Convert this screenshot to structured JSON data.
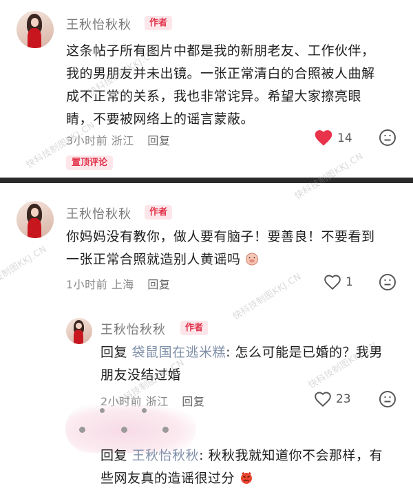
{
  "comments": [
    {
      "author": "王秋怡秋秋",
      "badge": "作者",
      "lines": [
        "这条帖子所有图片中都是我的新朋老友、工作伙伴，",
        "我的男朋友并未出镜。一张正常清白的合照被人曲解",
        "成不正常的关系，我也非常诧异。希望大家擦亮眼",
        "睛，不要被网络上的谣言蒙蔽。"
      ],
      "time": "3小时前",
      "location": "浙江",
      "reply_label": "回复",
      "likes": "14",
      "liked": true,
      "pin_label": "置顶评论"
    },
    {
      "author": "王秋怡秋秋",
      "badge": "作者",
      "lines": [
        "你妈妈没有教你，做人要有脑子！要善良！不要看到",
        "一张正常合照就造别人黄谣吗"
      ],
      "time": "1小时前",
      "location": "上海",
      "reply_label": "回复",
      "likes": "1"
    },
    {
      "author": "王秋怡秋秋",
      "badge": "作者",
      "reply_prefix": "回复",
      "reply_to": "袋鼠国在逃米糕",
      "line1_rest": ": 怎么可能是已婚的？我男",
      "line2": "朋友没结过婚",
      "time": "2小时前",
      "location": "浙江",
      "reply_label": "回复",
      "likes": "23"
    },
    {
      "reply_prefix": "回复",
      "reply_to": "王秋怡秋秋",
      "line1_rest": ": 秋秋我就知道你不会那样，有",
      "line2": "些网友真的造谣很过分"
    }
  ],
  "watermark": "快科技制图KKJ.CN",
  "colors": {
    "accent": "#e2324a",
    "heart": "#e8334a",
    "divider": "#2b2b2b"
  },
  "icons": [
    "heart-icon",
    "emoji-reaction-icon",
    "avatar"
  ]
}
